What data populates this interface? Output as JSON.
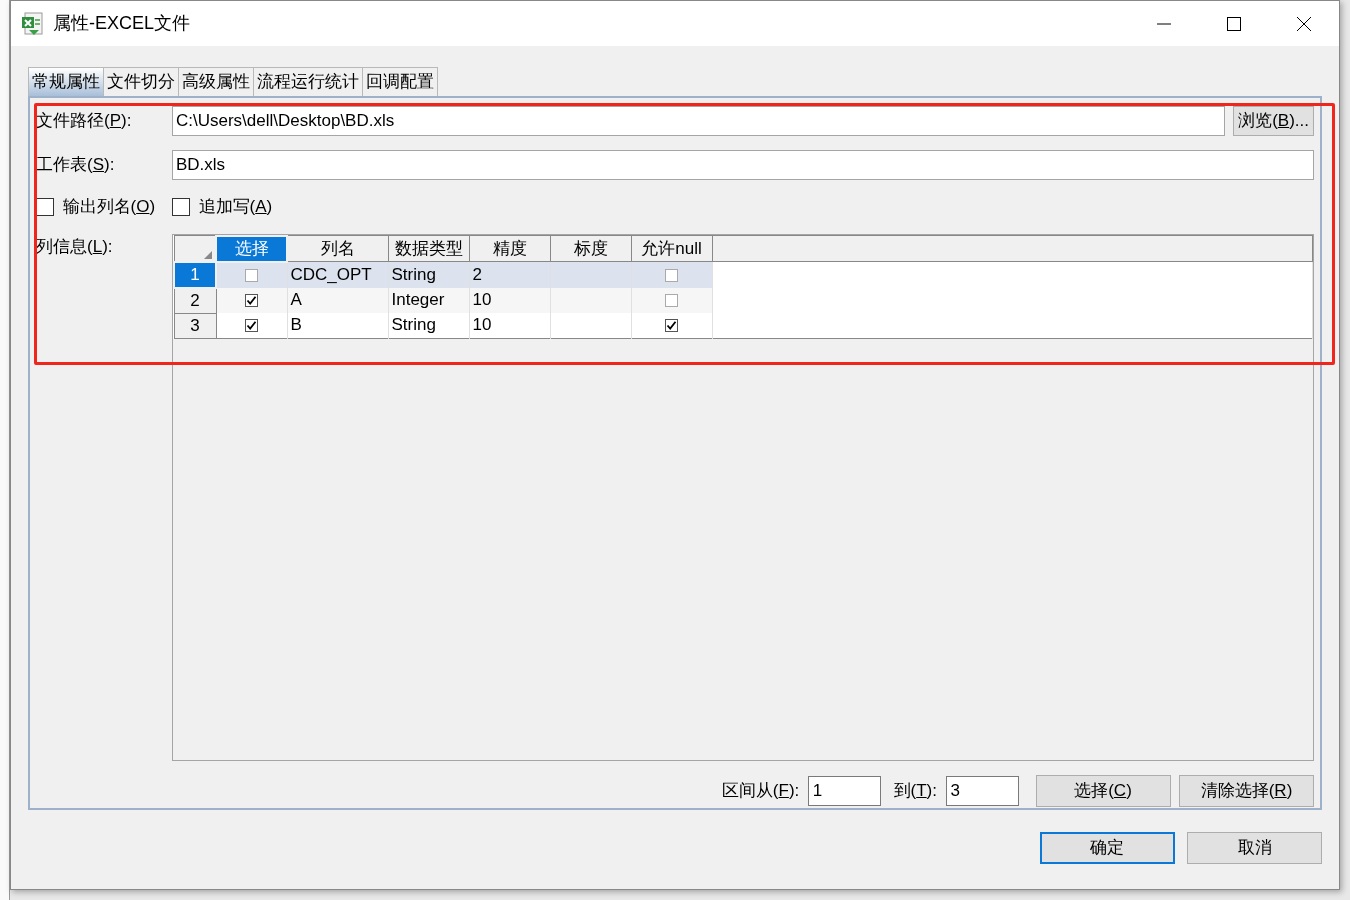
{
  "window": {
    "title": "属性-EXCEL文件"
  },
  "tabs": [
    {
      "label": "常规属性",
      "selected": true
    },
    {
      "label": "文件切分",
      "selected": false
    },
    {
      "label": "高级属性",
      "selected": false
    },
    {
      "label": "流程运行统计",
      "selected": false
    },
    {
      "label": "回调配置",
      "selected": false
    }
  ],
  "file_path": {
    "label": {
      "before": "文件路径(",
      "mnemonic": "P",
      "after": "):"
    },
    "value": "C:\\Users\\dell\\Desktop\\BD.xls",
    "browse_button": {
      "before": "浏览(",
      "mnemonic": "B",
      "after": ")..."
    }
  },
  "sheet": {
    "label": {
      "before": "工作表(",
      "mnemonic": "S",
      "after": "):"
    },
    "value": "BD.xls"
  },
  "options": [
    {
      "label": {
        "before": "输出列名(",
        "mnemonic": "O",
        "after": ")"
      },
      "checked": false
    },
    {
      "label": {
        "before": "追加写(",
        "mnemonic": "A",
        "after": ")"
      },
      "checked": false
    }
  ],
  "columns_label": {
    "before": "列信息(",
    "mnemonic": "L",
    "after": "):"
  },
  "table": {
    "columns": [
      {
        "label": "选择",
        "selected": true
      },
      {
        "label": "列名",
        "selected": false
      },
      {
        "label": "数据类型",
        "selected": false
      },
      {
        "label": "精度",
        "selected": false
      },
      {
        "label": "标度",
        "selected": false
      },
      {
        "label": "允许null",
        "selected": false
      }
    ],
    "rows": [
      {
        "number": "1",
        "selected": true,
        "chosen": false,
        "name": "CDC_OPT",
        "type": "String",
        "precision": "2",
        "allow_null": false
      },
      {
        "number": "2",
        "selected": false,
        "chosen": true,
        "name": "A",
        "type": "Integer",
        "precision": "10",
        "allow_null": false
      },
      {
        "number": "3",
        "selected": false,
        "chosen": true,
        "name": "B",
        "type": "String",
        "precision": "10",
        "allow_null": true
      }
    ]
  },
  "range": {
    "from_label": {
      "before": "区间从(",
      "mnemonic": "F",
      "after": "):"
    },
    "from_value": "1",
    "to_label": {
      "before": "到(",
      "mnemonic": "T",
      "after": "):"
    },
    "to_value": "3",
    "select_button": {
      "before": "选择(",
      "mnemonic": "C",
      "after": ")"
    },
    "clear_button": {
      "before": "清除选择(",
      "mnemonic": "R",
      "after": ")"
    }
  },
  "buttons": [
    {
      "label": "确定",
      "default": true
    },
    {
      "label": "取消",
      "default": false
    }
  ],
  "highlight": true
}
